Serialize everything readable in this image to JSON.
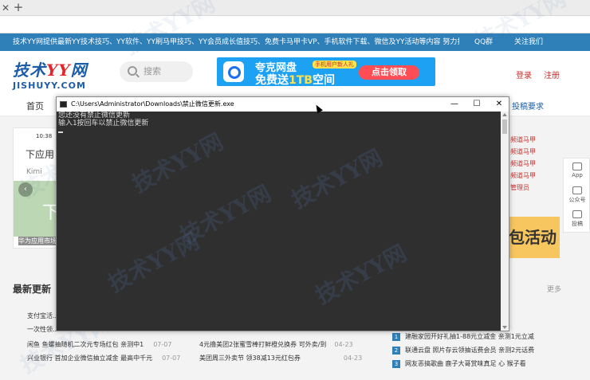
{
  "browser": {
    "close_glyph": "✕",
    "new_tab_glyph": "+"
  },
  "site": {
    "topbar_news": "技术YY网提供最新YY技术技巧、YY软件、YY刷马甲技巧、YY会员成长值技巧、免费卡马甲卡VP、手机软件下载、微信及YY活动等内容 努力打造为最全面的YY爱好者的家乐华",
    "qq_label": "QQ群",
    "wechat_label": "关注我们",
    "logo_main": "技术",
    "logo_yy": "YY",
    "logo_net": "网",
    "logo_sub": "JISHUYY.COM",
    "search_placeholder": "搜索",
    "banner": {
      "line1": "夸克网盘",
      "tag": "手机用户新人礼",
      "line2a": "免费送",
      "line2b": "1TB",
      "line2c": "空间",
      "button": "点击领取"
    },
    "login": "登录",
    "register": "注册",
    "nav_home": "首页",
    "nav_submit": "投稿要求",
    "card": {
      "time": "10:38",
      "title": "下应用",
      "kimi": "Kimi",
      "big": "下",
      "caption": "华为应用市场"
    },
    "right_links": [
      "频道马甲",
      "频道马甲",
      "频道马甲",
      "频道马甲",
      "管理员"
    ],
    "promo_text": "包活动",
    "sidebar": [
      {
        "label": "App"
      },
      {
        "label": "公众号"
      },
      {
        "label": "投稿"
      }
    ],
    "latest_title": "最新更新",
    "more": "更多",
    "left_rows": [
      {
        "text": "支付宝活...",
        "date": ""
      },
      {
        "text": "一次性领...",
        "date": ""
      },
      {
        "text": "闲鱼 鱼螺抽随机二次元专场红包 亲测中1",
        "date": "07-07"
      },
      {
        "text": "兴业银行 首加企业微信抽立减金 最高中千元",
        "date": "07-07"
      }
    ],
    "mid_rows": [
      {
        "text": "4元撸美团2张蜜雪棒打鲜橙兑换券 可外卖/到",
        "date": "04-23"
      },
      {
        "text": "美团周三外卖节 领38减13元红包券",
        "date": "04-23"
      }
    ],
    "rank_rows": [
      {
        "n": "1",
        "text": "建融家园开好礼抽1-88元立减金 亲测1元立减"
      },
      {
        "n": "2",
        "text": "联通云盘 照片存云领抽话费会员 亲测2元话费"
      },
      {
        "n": "3",
        "text": "网友恶搞歌曲 鹿子大哥赏味真足 心 猴子看"
      }
    ]
  },
  "console": {
    "title": "C:\\Users\\Administrator\\Downloads\\禁止微信更新.exe",
    "lines": [
      "您还没有禁止微信更新",
      "输入1按回车以禁止微信更新"
    ],
    "minimize": "—",
    "maximize": "☐",
    "close": "✕"
  },
  "watermark": "技术YY网"
}
